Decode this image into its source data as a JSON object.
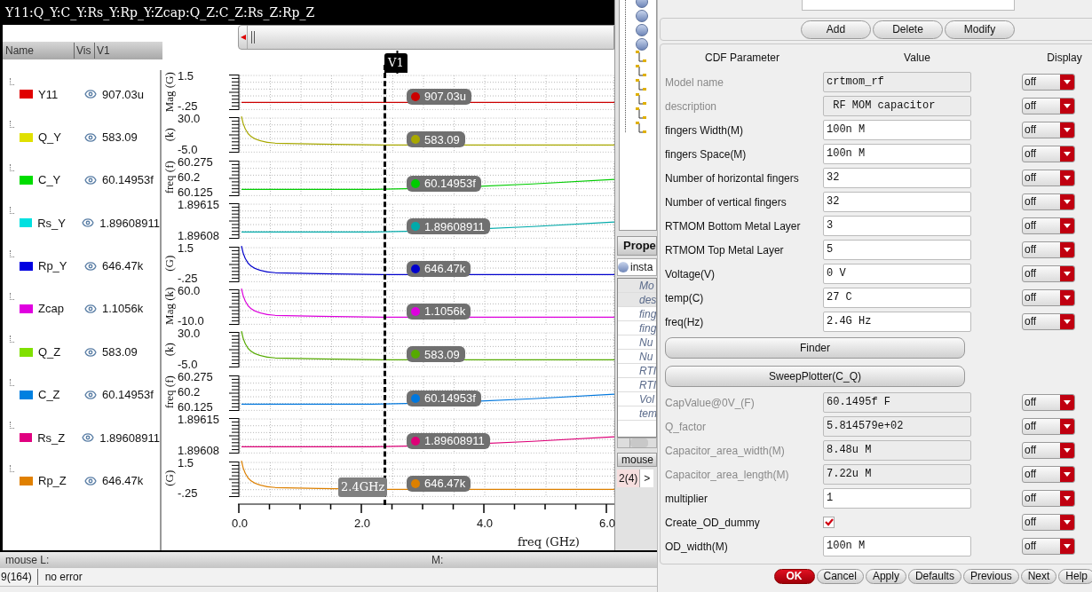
{
  "window": {
    "title": "Y11:Q_Y:C_Y:Rs_Y:Rp_Y:Zcap:Q_Z:C_Z:Rs_Z:Rp_Z"
  },
  "legend": {
    "columns": [
      "Name",
      "Vis",
      "V1"
    ],
    "rows": [
      {
        "name": "Y11",
        "color": "#e00000",
        "value": "907.03u",
        "visible": true
      },
      {
        "name": "Q_Y",
        "color": "#e0e000",
        "value": "583.09",
        "visible": true
      },
      {
        "name": "C_Y",
        "color": "#00dd00",
        "value": "60.14953f",
        "visible": true
      },
      {
        "name": "Rs_Y",
        "color": "#00e0e0",
        "value": "1.89608911",
        "visible": true
      },
      {
        "name": "Rp_Y",
        "color": "#0000e0",
        "value": "646.47k",
        "visible": true
      },
      {
        "name": "Zcap",
        "color": "#e000e0",
        "value": "1.1056k",
        "visible": true
      },
      {
        "name": "Q_Z",
        "color": "#80e000",
        "value": "583.09",
        "visible": true
      },
      {
        "name": "C_Z",
        "color": "#0080e0",
        "value": "60.14953f",
        "visible": true
      },
      {
        "name": "Rs_Z",
        "color": "#e00080",
        "value": "1.89608911",
        "visible": true
      },
      {
        "name": "Rp_Z",
        "color": "#e08000",
        "value": "646.47k",
        "visible": true
      }
    ]
  },
  "plot": {
    "cursor": {
      "label": "V1",
      "readout": "2.4GHz"
    },
    "xticks": [
      "0.0",
      "2.0",
      "4.0",
      "6.0"
    ],
    "xlabel": "freq (GHz)",
    "strips": [
      {
        "unit": "Mag (G)",
        "ticks": [
          "1.5",
          "-.25"
        ],
        "kind": "flat",
        "color": "#cc0000",
        "marker": "907.03u"
      },
      {
        "unit": "(k)",
        "ticks": [
          "30.0",
          "-5.0"
        ],
        "kind": "decay",
        "color": "#a8a800",
        "marker": "583.09"
      },
      {
        "unit": "freq (f)",
        "ticks": [
          "60.275",
          "60.2",
          "60.125"
        ],
        "kind": "rising",
        "color": "#00cc00",
        "marker": "60.14953f"
      },
      {
        "ticks": [
          "1.89615",
          "1.89608"
        ],
        "kind": "rising",
        "color": "#00aaaa",
        "marker": "1.89608911"
      },
      {
        "unit": "(G)",
        "ticks": [
          "1.5",
          "-.25"
        ],
        "kind": "decay",
        "color": "#0000cc",
        "marker": "646.47k"
      },
      {
        "unit": "Mag (k)",
        "ticks": [
          "60.0",
          "-10.0"
        ],
        "kind": "decay",
        "color": "#dd00dd",
        "marker": "1.1056k"
      },
      {
        "unit": "(k)",
        "ticks": [
          "30.0",
          "-5.0"
        ],
        "kind": "decay",
        "color": "#55aa00",
        "marker": "583.09"
      },
      {
        "unit": "freq (f)",
        "ticks": [
          "60.275",
          "60.2",
          "60.125"
        ],
        "kind": "rising",
        "color": "#0077dd",
        "marker": "60.14953f"
      },
      {
        "ticks": [
          "1.89615",
          "1.89608"
        ],
        "kind": "rising",
        "color": "#dd0077",
        "marker": "1.89608911"
      },
      {
        "unit": "(G)",
        "ticks": [
          "1.5",
          "-.25"
        ],
        "kind": "decay",
        "color": "#dd8000",
        "marker": "646.47k"
      }
    ]
  },
  "side_panel": {
    "tab": "Prope",
    "object": "insta",
    "items": [
      "Mo",
      "des",
      "fing",
      "fing",
      "Nu",
      "Nu",
      "RTI",
      "RTI",
      "Vol",
      "tem"
    ],
    "mouse_tab": "mouse",
    "page": "2(4)",
    "next": ">"
  },
  "status": {
    "mouse": "mouse L:",
    "middle": "M:",
    "count": "9(164)",
    "message": "no error"
  },
  "form": {
    "top_buttons": [
      "Add",
      "Delete",
      "Modify"
    ],
    "headers": [
      "CDF Parameter",
      "Value",
      "Display"
    ],
    "rows": [
      {
        "kind": "field",
        "label": "Model name",
        "value": "crtmom_rf",
        "editable": false,
        "display": "off"
      },
      {
        "kind": "field",
        "label": "description",
        "value": " RF MOM capacitor",
        "editable": false,
        "display": "off"
      },
      {
        "kind": "field",
        "label": "fingers Width(M)",
        "value": "100n M",
        "editable": true,
        "display": "off"
      },
      {
        "kind": "field",
        "label": "fingers Space(M)",
        "value": "100n M",
        "editable": true,
        "display": "off"
      },
      {
        "kind": "field",
        "label": "Number of horizontal fingers",
        "value": "32",
        "editable": true,
        "display": "off"
      },
      {
        "kind": "field",
        "label": "Number of vertical fingers",
        "value": "32",
        "editable": true,
        "display": "off"
      },
      {
        "kind": "field",
        "label": "RTMOM Bottom Metal Layer",
        "value": "3",
        "editable": true,
        "display": "off"
      },
      {
        "kind": "field",
        "label": "RTMOM Top Metal Layer",
        "value": "5",
        "editable": true,
        "display": "off"
      },
      {
        "kind": "field",
        "label": "Voltage(V)",
        "value": "0 V",
        "editable": true,
        "display": "off"
      },
      {
        "kind": "field",
        "label": "temp(C)",
        "value": "27 C",
        "editable": true,
        "display": "off"
      },
      {
        "kind": "field",
        "label": "freq(Hz)",
        "value": "2.4G Hz",
        "editable": true,
        "display": "off"
      },
      {
        "kind": "button",
        "label": "Finder"
      },
      {
        "kind": "button",
        "label": "SweepPlotter(C_Q)"
      },
      {
        "kind": "field",
        "label": "CapValue@0V_(F)",
        "value": "60.1495f F",
        "editable": false,
        "display": "off"
      },
      {
        "kind": "field",
        "label": "Q_factor",
        "value": "5.814579e+02",
        "editable": false,
        "display": "off"
      },
      {
        "kind": "field",
        "label": "Capacitor_area_width(M)",
        "value": "8.48u M",
        "editable": false,
        "display": "off"
      },
      {
        "kind": "field",
        "label": "Capacitor_area_length(M)",
        "value": "7.22u M",
        "editable": false,
        "display": "off"
      },
      {
        "kind": "field",
        "label": "multiplier",
        "value": "1",
        "editable": true,
        "display": "off"
      },
      {
        "kind": "checkbox",
        "label": "Create_OD_dummy",
        "checked": true,
        "display": "off"
      },
      {
        "kind": "field",
        "label": "OD_width(M)",
        "value": "100n M",
        "editable": true,
        "display": "off"
      }
    ],
    "dialog_buttons": [
      {
        "label": "OK",
        "kind": "primary"
      },
      {
        "label": "Cancel",
        "kind": "normal"
      },
      {
        "label": "Apply",
        "kind": "normal"
      },
      {
        "label": "Defaults",
        "kind": "normal"
      },
      {
        "label": "Previous",
        "kind": "normal"
      },
      {
        "label": "Next",
        "kind": "normal"
      },
      {
        "label": "Help",
        "kind": "normal"
      }
    ]
  }
}
